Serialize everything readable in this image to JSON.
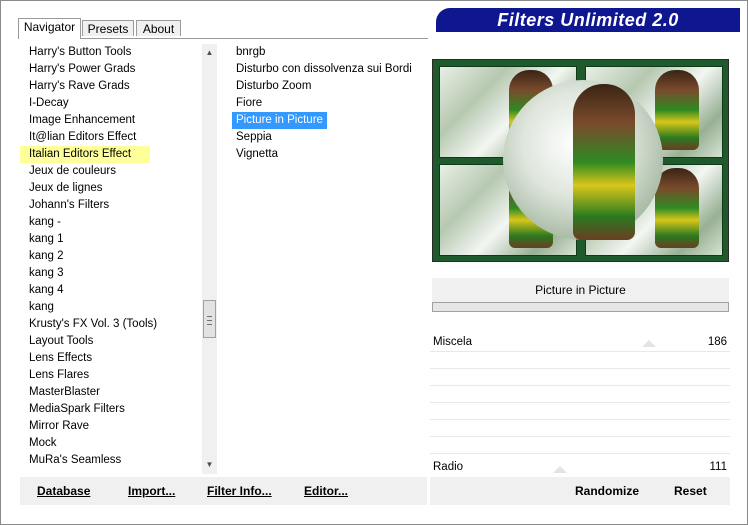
{
  "app": {
    "title": "Filters Unlimited 2.0"
  },
  "tabs": [
    {
      "label": "Navigator",
      "active": true
    },
    {
      "label": "Presets",
      "active": false
    },
    {
      "label": "About",
      "active": false
    }
  ],
  "categories": [
    "Harry's Button Tools",
    "Harry's Power Grads",
    "Harry's Rave Grads",
    "I-Decay",
    "Image Enhancement",
    "It@lian Editors Effect",
    "Italian Editors Effect",
    "Jeux de couleurs",
    "Jeux de lignes",
    "Johann's Filters",
    "kang -",
    "kang 1",
    "kang 2",
    "kang 3",
    "kang 4",
    "kang",
    "Krusty's FX Vol. 3 (Tools)",
    "Layout Tools",
    "Lens Effects",
    "Lens Flares",
    "MasterBlaster",
    "MediaSpark Filters",
    "Mirror Rave",
    "Mock",
    "MuRa's Seamless"
  ],
  "selected_category_index": 6,
  "filters": [
    "bnrgb",
    "Disturbo con dissolvenza sui Bordi",
    "Disturbo Zoom",
    "Fiore",
    "Picture in Picture",
    "Seppia",
    "Vignetta"
  ],
  "selected_filter_index": 4,
  "preview": {
    "filter_name": "Picture in Picture"
  },
  "params": [
    {
      "label": "Miscela",
      "value": "186"
    },
    {
      "label": "Radio",
      "value": "111"
    }
  ],
  "buttons": {
    "database": "Database",
    "import": "Import...",
    "filter_info": "Filter Info...",
    "editor": "Editor...",
    "randomize": "Randomize",
    "reset": "Reset"
  },
  "icons": {
    "scroll_up": "scroll-up-arrow-icon",
    "scroll_down": "scroll-down-arrow-icon"
  },
  "colors": {
    "banner": "#0e1690",
    "category_highlight": "#ffff99",
    "filter_highlight": "#3399ff"
  }
}
